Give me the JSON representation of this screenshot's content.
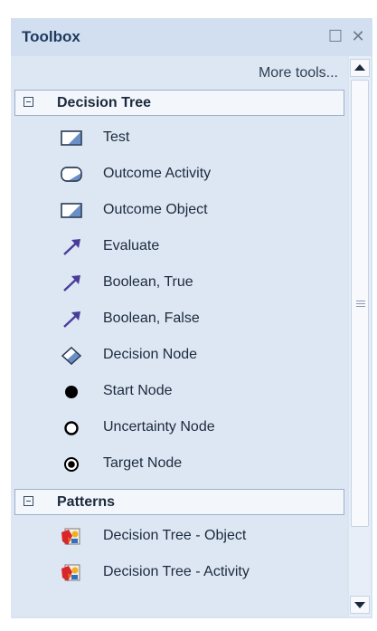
{
  "window": {
    "title": "Toolbox",
    "buttons": [
      {
        "name": "restore-icon",
        "glyph": "☐"
      },
      {
        "name": "close-icon",
        "glyph": "✕"
      }
    ]
  },
  "more_tools_label": "More tools...",
  "groups": [
    {
      "label": "Decision Tree",
      "expanded": true,
      "items": [
        {
          "label": "Test",
          "icon": "rectangle-shaded-icon"
        },
        {
          "label": "Outcome Activity",
          "icon": "rounded-rectangle-icon"
        },
        {
          "label": "Outcome Object",
          "icon": "rectangle-shaded-icon"
        },
        {
          "label": "Evaluate",
          "icon": "arrow-icon"
        },
        {
          "label": "Boolean, True",
          "icon": "arrow-icon"
        },
        {
          "label": "Boolean, False",
          "icon": "arrow-icon"
        },
        {
          "label": "Decision Node",
          "icon": "diamond-icon"
        },
        {
          "label": "Start Node",
          "icon": "filled-circle-icon"
        },
        {
          "label": "Uncertainty Node",
          "icon": "hollow-circle-icon"
        },
        {
          "label": "Target Node",
          "icon": "target-circle-icon"
        }
      ]
    },
    {
      "label": "Patterns",
      "expanded": true,
      "items": [
        {
          "label": "Decision Tree - Object",
          "icon": "pattern-icon"
        },
        {
          "label": "Decision Tree - Activity",
          "icon": "pattern-icon"
        }
      ]
    }
  ],
  "colors": {
    "panel_background": "#dde7f3",
    "title_text": "#1e3a5f",
    "arrow_icon": "#4a3c9a",
    "shape_fill": "#6a8fc6"
  }
}
